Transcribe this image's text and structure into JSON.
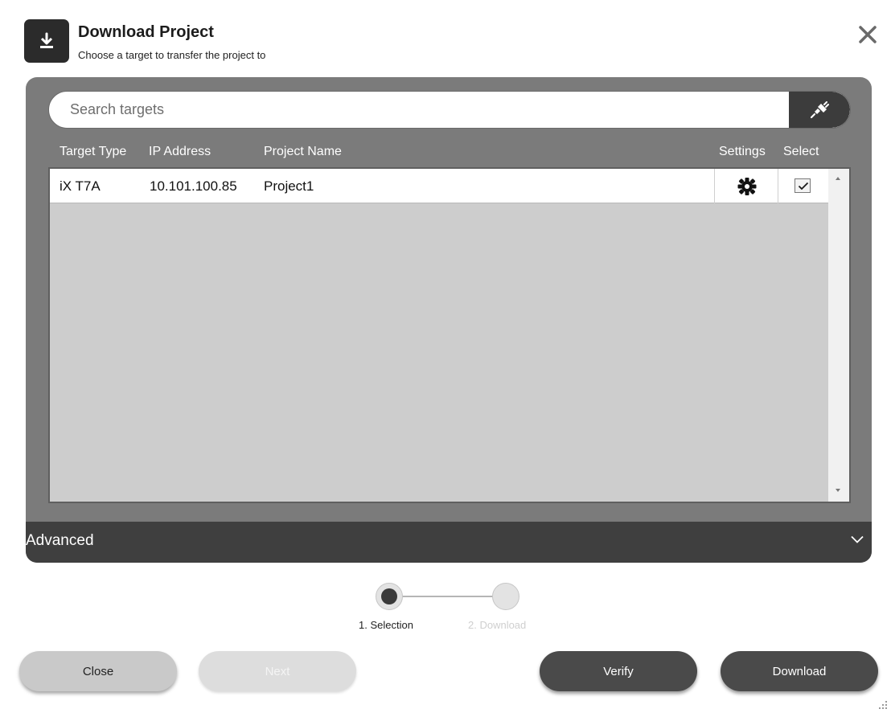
{
  "header": {
    "title": "Download Project",
    "subtitle": "Choose a target to transfer the project to",
    "icon": "download-icon",
    "close_icon": "close-icon"
  },
  "search": {
    "placeholder": "Search targets",
    "value": "",
    "button_icon": "connect-plug-icon"
  },
  "table": {
    "columns": [
      "Target Type",
      "IP Address",
      "Project Name",
      "Settings",
      "Select"
    ],
    "rows": [
      {
        "target_type": "iX T7A",
        "ip_address": "10.101.100.85",
        "project_name": "Project1",
        "settings_icon": "gear-icon",
        "selected": true
      }
    ]
  },
  "advanced": {
    "label": "Advanced",
    "icon": "chevron-down-icon"
  },
  "stepper": {
    "steps": [
      {
        "label": "1. Selection",
        "state": "active"
      },
      {
        "label": "2. Download",
        "state": "inactive"
      }
    ]
  },
  "buttons": {
    "close": "Close",
    "next": "Next",
    "verify": "Verify",
    "download": "Download"
  },
  "colors": {
    "panel": "#7b7b7b",
    "panel_footer": "#3f3f3f",
    "primary_button": "#4a4a4a",
    "secondary_button": "#c9c9c9",
    "disabled_button": "#dddddd"
  }
}
